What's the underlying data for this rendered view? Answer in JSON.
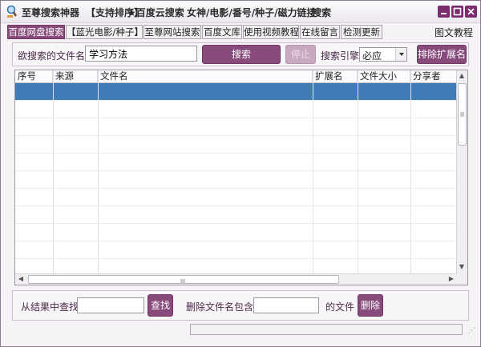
{
  "titlebar": {
    "app_name": "至尊搜索神器",
    "menu": [
      "【支持排序】",
      "★百度云搜索",
      "女神/电影/番号/种子/磁力链接",
      "搜索"
    ]
  },
  "tabs": [
    {
      "label": "百度网盘搜索",
      "active": true
    },
    {
      "label": "【蓝光电影/种子】",
      "active": false
    },
    {
      "label": "至尊网站搜索",
      "active": false
    },
    {
      "label": "百度文库",
      "active": false
    },
    {
      "label": "使用视频教程",
      "active": false
    },
    {
      "label": "在线留言",
      "active": false
    },
    {
      "label": "检测更新",
      "active": false
    }
  ],
  "help_link": "图文教程",
  "search": {
    "filename_label": "欲搜索的文件名:",
    "filename_value": "学习方法",
    "search_button": "搜索",
    "stop_button": "停止",
    "engine_label": "搜索引擎",
    "engine_selected": "必应",
    "exclude_ext_button": "排除扩展名"
  },
  "table": {
    "columns": [
      "序号",
      "来源",
      "文件名",
      "扩展名",
      "文件大小",
      "分享者"
    ],
    "rows": []
  },
  "filter": {
    "find_label": "从结果中查找:",
    "find_value": "",
    "find_button": "查找",
    "delete_label": "删除文件名包含:",
    "delete_value": "",
    "delete_suffix": "的文件",
    "delete_button": "删除"
  },
  "colors": {
    "accent": "#874a7b",
    "selection": "#3f7bb6"
  }
}
